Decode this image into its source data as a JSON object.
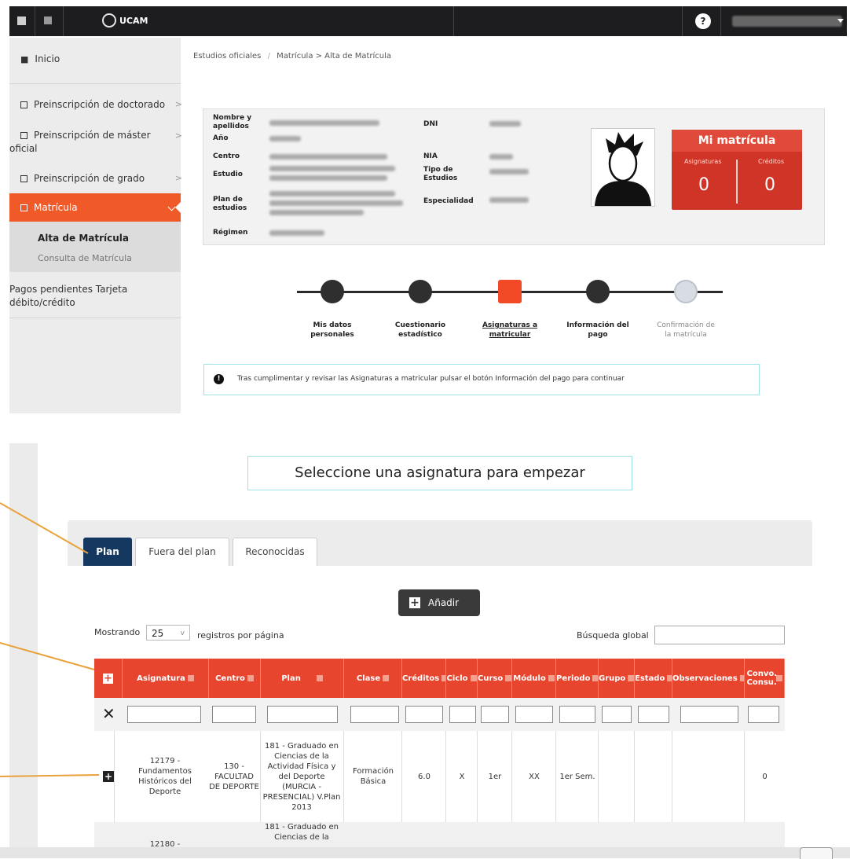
{
  "topbar": {
    "logo_text": "UCAM",
    "help_icon_text": "?"
  },
  "sidebar": {
    "items": [
      {
        "label": "Inicio",
        "icon": "home-icon"
      },
      {
        "label": "Preinscripción de doctorado",
        "icon": "square-icon"
      },
      {
        "label": "Preinscripción de máster",
        "label2": "oficial",
        "icon": "square-icon"
      },
      {
        "label": "Preinscripción de grado",
        "icon": "square-icon"
      },
      {
        "label": "Matrícula",
        "icon": "square-icon"
      }
    ],
    "sub_items": [
      "Alta de Matrícula",
      "Consulta de Matrícula"
    ],
    "pagos_line1": "Pagos pendientes Tarjeta",
    "pagos_line2": "débito/crédito"
  },
  "breadcrumb": {
    "root": "Estudios oficiales",
    "sep": "/",
    "path": "Matrícula > Alta de Matrícula"
  },
  "info": {
    "nombre_l1": "Nombre y",
    "nombre_l2": "apellidos",
    "ano": "Año",
    "centro": "Centro",
    "estudio": "Estudio",
    "plan_l1": "Plan de",
    "plan_l2": "estudios",
    "regimen": "Régimen",
    "dni": "DNI",
    "nia": "NIA",
    "tipo_l1": "Tipo de",
    "tipo_l2": "Estudios",
    "especialidad": "Especialidad"
  },
  "mi_matricula": {
    "title": "Mi matrícula",
    "asignaturas_label": "Asignaturas",
    "creditos_label": "Créditos",
    "asignaturas_value": "0",
    "creditos_value": "0"
  },
  "steps": [
    {
      "l1": "Mis datos",
      "l2": "personales",
      "state": "done"
    },
    {
      "l1": "Cuestionario",
      "l2": "estadístico",
      "state": "done"
    },
    {
      "l1": "Asignaturas a",
      "l2": "matricular",
      "state": "current"
    },
    {
      "l1": "Información del",
      "l2": "pago",
      "state": "done"
    },
    {
      "l1": "Confirmación de",
      "l2": "la matrícula",
      "state": "pending"
    }
  ],
  "alert_text": "Tras cumplimentar y revisar las Asignaturas a matricular pulsar el botón Información del pago para continuar",
  "select_title": "Seleccione una asignatura para empezar",
  "tabs": [
    "Plan",
    "Fuera del plan",
    "Reconocidas"
  ],
  "add_button": "Añadir",
  "mostrando": "Mostrando",
  "page_size": "25",
  "registros": "registros por página",
  "busqueda": "Búsqueda global",
  "table": {
    "columns": [
      "Asignatura",
      "Centro",
      "Plan",
      "Clase",
      "Créditos",
      "Ciclo",
      "Curso",
      "Módulo",
      "Periodo",
      "Grupo",
      "Estado",
      "Observaciones",
      "Convo. Consu."
    ],
    "row1": {
      "asignatura": "12179 - Fundamentos Históricos del Deporte",
      "centro": "130 - FACULTAD DE DEPORTE",
      "plan": "181 - Graduado en Ciencias de la Actividad Física y del Deporte (MURCIA - PRESENCIAL) V.Plan 2013",
      "clase": "Formación Básica",
      "creditos": "6.0",
      "ciclo": "X",
      "curso": "1er",
      "modulo": "XX",
      "periodo": "1er Sem.",
      "grupo": "",
      "estado": "",
      "observaciones": "",
      "convo": "0"
    },
    "row2": {
      "asignatura": "12180 -",
      "plan": "181 - Graduado en Ciencias de la"
    }
  },
  "colors": {
    "accent": "#f05a28",
    "table_header": "#e8452f",
    "topbar": "#1d1d1f",
    "card_red": "#cf3426",
    "tab_active": "#14385f"
  }
}
